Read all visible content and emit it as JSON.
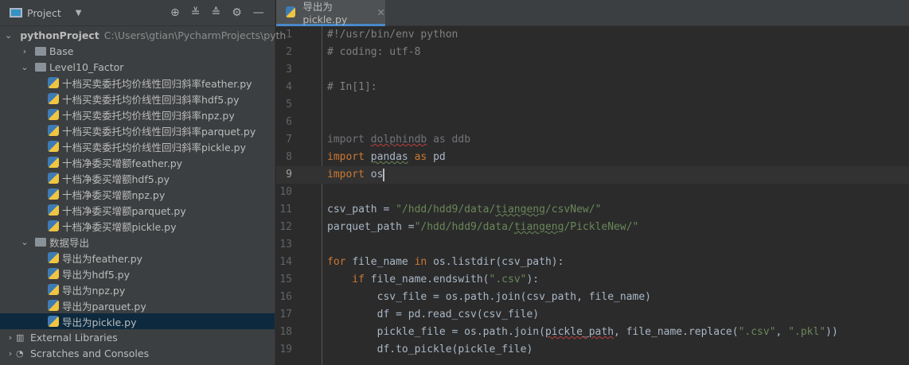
{
  "sidebar": {
    "title": "Project",
    "root": {
      "name": "pythonProject",
      "path": "C:\\Users\\gtian\\PycharmProjects\\pyth"
    },
    "tree": [
      {
        "label": "Base",
        "level": 1,
        "type": "folder",
        "expanded": false
      },
      {
        "label": "Level10_Factor",
        "level": 1,
        "type": "folder",
        "expanded": true
      },
      {
        "label": "十档买卖委托均价线性回归斜率feather.py",
        "level": 2,
        "type": "py"
      },
      {
        "label": "十档买卖委托均价线性回归斜率hdf5.py",
        "level": 2,
        "type": "py"
      },
      {
        "label": "十档买卖委托均价线性回归斜率npz.py",
        "level": 2,
        "type": "py"
      },
      {
        "label": "十档买卖委托均价线性回归斜率parquet.py",
        "level": 2,
        "type": "py"
      },
      {
        "label": "十档买卖委托均价线性回归斜率pickle.py",
        "level": 2,
        "type": "py"
      },
      {
        "label": "十档净委买增额feather.py",
        "level": 2,
        "type": "py"
      },
      {
        "label": "十档净委买增额hdf5.py",
        "level": 2,
        "type": "py"
      },
      {
        "label": "十档净委买增额npz.py",
        "level": 2,
        "type": "py"
      },
      {
        "label": "十档净委买增额parquet.py",
        "level": 2,
        "type": "py"
      },
      {
        "label": "十档净委买增额pickle.py",
        "level": 2,
        "type": "py"
      },
      {
        "label": "数据导出",
        "level": 1,
        "type": "folder",
        "expanded": true
      },
      {
        "label": "导出为feather.py",
        "level": 2,
        "type": "py"
      },
      {
        "label": "导出为hdf5.py",
        "level": 2,
        "type": "py"
      },
      {
        "label": "导出为npz.py",
        "level": 2,
        "type": "py"
      },
      {
        "label": "导出为parquet.py",
        "level": 2,
        "type": "py"
      },
      {
        "label": "导出为pickle.py",
        "level": 2,
        "type": "py",
        "selected": true
      }
    ],
    "bottom": [
      "External Libraries",
      "Scratches and Consoles"
    ]
  },
  "tab": {
    "label": "导出为pickle.py"
  },
  "editor": {
    "current_line": 9,
    "lines": [
      [
        [
          "#!/usr/bin/env python",
          "cm"
        ]
      ],
      [
        [
          "# coding: utf-8",
          "cm"
        ]
      ],
      [],
      [
        [
          "# In[1]:",
          "cm"
        ]
      ],
      [],
      [],
      [
        [
          "import ",
          "dim"
        ],
        [
          "dolphindb",
          "dim wv"
        ],
        [
          " as ddb",
          "dim"
        ]
      ],
      [
        [
          "import ",
          "kw"
        ],
        [
          "pandas",
          "id wg"
        ],
        [
          " as ",
          "kw"
        ],
        [
          "pd",
          "id"
        ]
      ],
      [
        [
          "import ",
          "kw"
        ],
        [
          "os",
          "id"
        ]
      ],
      [],
      [
        [
          "csv_path = ",
          "id"
        ],
        [
          "\"/hdd/hdd9/data/",
          "st"
        ],
        [
          "tiangeng",
          "st wg"
        ],
        [
          "/csvNew/\"",
          "st"
        ]
      ],
      [
        [
          "parquet_path =",
          "id"
        ],
        [
          "\"/hdd/hdd9/data/",
          "st"
        ],
        [
          "tiangeng",
          "st wg"
        ],
        [
          "/PickleNew/\"",
          "st"
        ]
      ],
      [],
      [
        [
          "for ",
          "kw"
        ],
        [
          "file_name ",
          "id"
        ],
        [
          "in ",
          "kw"
        ],
        [
          "os.listdir(csv_path):",
          "id"
        ]
      ],
      [
        [
          "    if ",
          "kw"
        ],
        [
          "file_name.endswith(",
          "id"
        ],
        [
          "\".csv\"",
          "st"
        ],
        [
          "):",
          "id"
        ]
      ],
      [
        [
          "        csv_file = os.path.join(csv_path, file_name)",
          "id"
        ]
      ],
      [
        [
          "        df = pd.read_csv(csv_file)",
          "id"
        ]
      ],
      [
        [
          "        pickle_file = os.path.join(",
          "id"
        ],
        [
          "pickle_path",
          "id wv"
        ],
        [
          ", file_name.replace(",
          "id"
        ],
        [
          "\".csv\"",
          "st"
        ],
        [
          ", ",
          "id"
        ],
        [
          "\".pkl\"",
          "st"
        ],
        [
          "))",
          "id"
        ]
      ],
      [
        [
          "        df.to_pickle(pickle_file)",
          "id"
        ]
      ]
    ]
  }
}
